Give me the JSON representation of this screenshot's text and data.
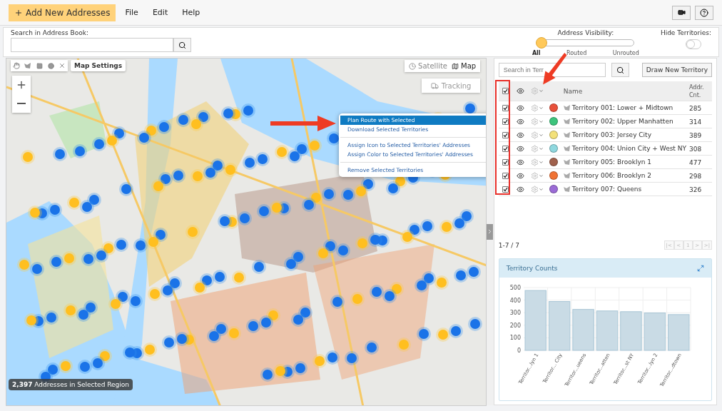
{
  "toolbar": {
    "add_button": "Add New Addresses",
    "menu": [
      "File",
      "Edit",
      "Help"
    ]
  },
  "search": {
    "label": "Search in Address Book:"
  },
  "visibility": {
    "label": "Address Visibility:",
    "level": 0,
    "options": [
      {
        "label": "All",
        "selected": true
      },
      {
        "label": "Routed",
        "selected": false
      },
      {
        "label": "Unrouted",
        "selected": false
      }
    ]
  },
  "hide_territories": {
    "label": "Hide Territories:",
    "on": false
  },
  "map": {
    "settings_button": "Map Settings",
    "map_types": [
      {
        "label": "Satellite",
        "selected": false
      },
      {
        "label": "Map",
        "selected": true
      }
    ],
    "tracking_button": "Tracking",
    "context_menu": [
      [
        {
          "label": "Plan Route with Selected",
          "selected": true
        },
        {
          "label": "Download Selected Territories",
          "selected": false
        }
      ],
      [
        {
          "label": "Assign Icon to Selected Territories' Addresses",
          "selected": false
        },
        {
          "label": "Assign Color to Selected Territories' Addresses",
          "selected": false
        }
      ],
      [
        {
          "label": "Remove Selected Territories",
          "selected": false
        }
      ]
    ],
    "status": "**2,397** Addresses in Selected Region"
  },
  "territories": {
    "search_placeholder": "Search in Terr",
    "draw_button": "Draw New Territory",
    "columns": [
      "Name",
      "Addr. Cnt."
    ],
    "all_checked": true,
    "rows": [
      {
        "name": "Territory 001: Lower + Midtown",
        "count": "285",
        "checked": true,
        "color": "#e8503a"
      },
      {
        "name": "Territory 002: Upper Manhatten",
        "count": "314",
        "checked": true,
        "color": "#3cc47c"
      },
      {
        "name": "Territory 003: Jersey City",
        "count": "389",
        "checked": true,
        "color": "#f3e17a"
      },
      {
        "name": "Territory 004: Union City + West NY",
        "count": "308",
        "checked": true,
        "color": "#8fd8df"
      },
      {
        "name": "Territory 005: Brooklyn 1",
        "count": "477",
        "checked": true,
        "color": "#a0614c"
      },
      {
        "name": "Territory 006: Brooklyn 2",
        "count": "298",
        "checked": true,
        "color": "#f07234"
      },
      {
        "name": "Territory 007: Queens",
        "count": "326",
        "checked": true,
        "color": "#9b6bd6"
      }
    ],
    "pager": {
      "range": "1-7 / 7",
      "pages": [
        "|<",
        "<",
        "1",
        ">",
        ">|"
      ]
    }
  },
  "chart_panel": {
    "title": "Territory Counts",
    "chart_data": {
      "type": "bar",
      "categories": [
        "Territor...lyn 1",
        "Territor... City",
        "Territor...ueens",
        "Territor...atten",
        "Territor...st NY",
        "Territor...lyn 2",
        "Territor...dtown"
      ],
      "values": [
        477,
        389,
        326,
        314,
        308,
        298,
        285
      ],
      "grid": true,
      "ylim": [
        0,
        500
      ],
      "yticks": [
        0,
        100,
        200,
        300,
        400,
        500
      ]
    }
  }
}
